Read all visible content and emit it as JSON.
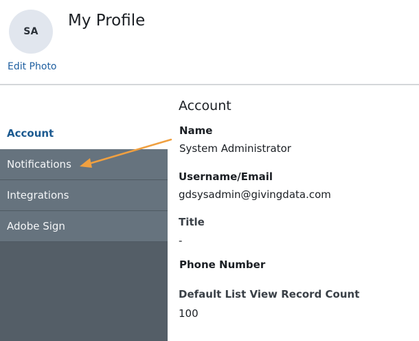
{
  "profile": {
    "avatar_initials": "SA",
    "edit_photo_label": "Edit Photo",
    "title": "My Profile"
  },
  "sidebar": {
    "items": [
      {
        "label": "Account",
        "active": true
      },
      {
        "label": "Notifications"
      },
      {
        "label": "Integrations"
      },
      {
        "label": "Adobe Sign"
      }
    ]
  },
  "account": {
    "section_title": "Account",
    "fields": [
      {
        "label": "Name",
        "value": "System Administrator"
      },
      {
        "label": "Username/Email",
        "value": "gdsysadmin@givingdata.com"
      },
      {
        "label": "Title",
        "value": "-"
      },
      {
        "label": "Phone Number",
        "value": ""
      },
      {
        "label": "Default List View Record Count",
        "value": "100"
      }
    ]
  },
  "colors": {
    "accent": "#1c5a90",
    "sidebar_bg": "#545e67",
    "sidebar_item_bg": "#66737e",
    "annotation_arrow": "#f0a040"
  }
}
